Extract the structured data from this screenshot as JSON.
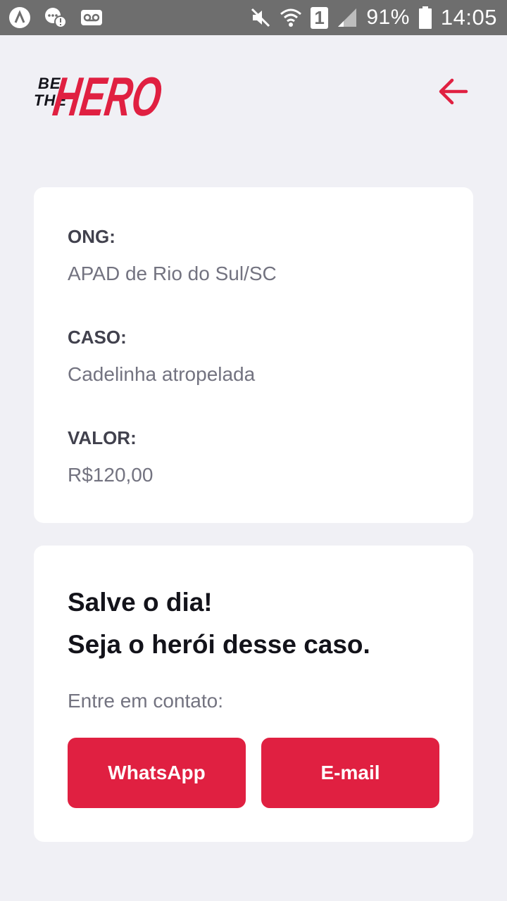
{
  "status_bar": {
    "battery_percent": "91%",
    "time": "14:05",
    "sim_slot": "1"
  },
  "header": {
    "logo_line1": "BE",
    "logo_line2": "THE",
    "logo_word": "HERO",
    "back_icon": "arrow-left-icon"
  },
  "incident": {
    "ong_label": "ONG:",
    "ong_value": "APAD de Rio do Sul/SC",
    "caso_label": "CASO:",
    "caso_value": "Cadelinha atropelada",
    "valor_label": "VALOR:",
    "valor_value": "R$120,00"
  },
  "contact": {
    "title_line1": "Salve o dia!",
    "title_line2": "Seja o herói desse caso.",
    "description": "Entre em contato:",
    "whatsapp_label": "WhatsApp",
    "email_label": "E-mail"
  },
  "colors": {
    "accent": "#e02041",
    "background": "#f0f0f5",
    "status_bar": "#6e6e6e"
  }
}
